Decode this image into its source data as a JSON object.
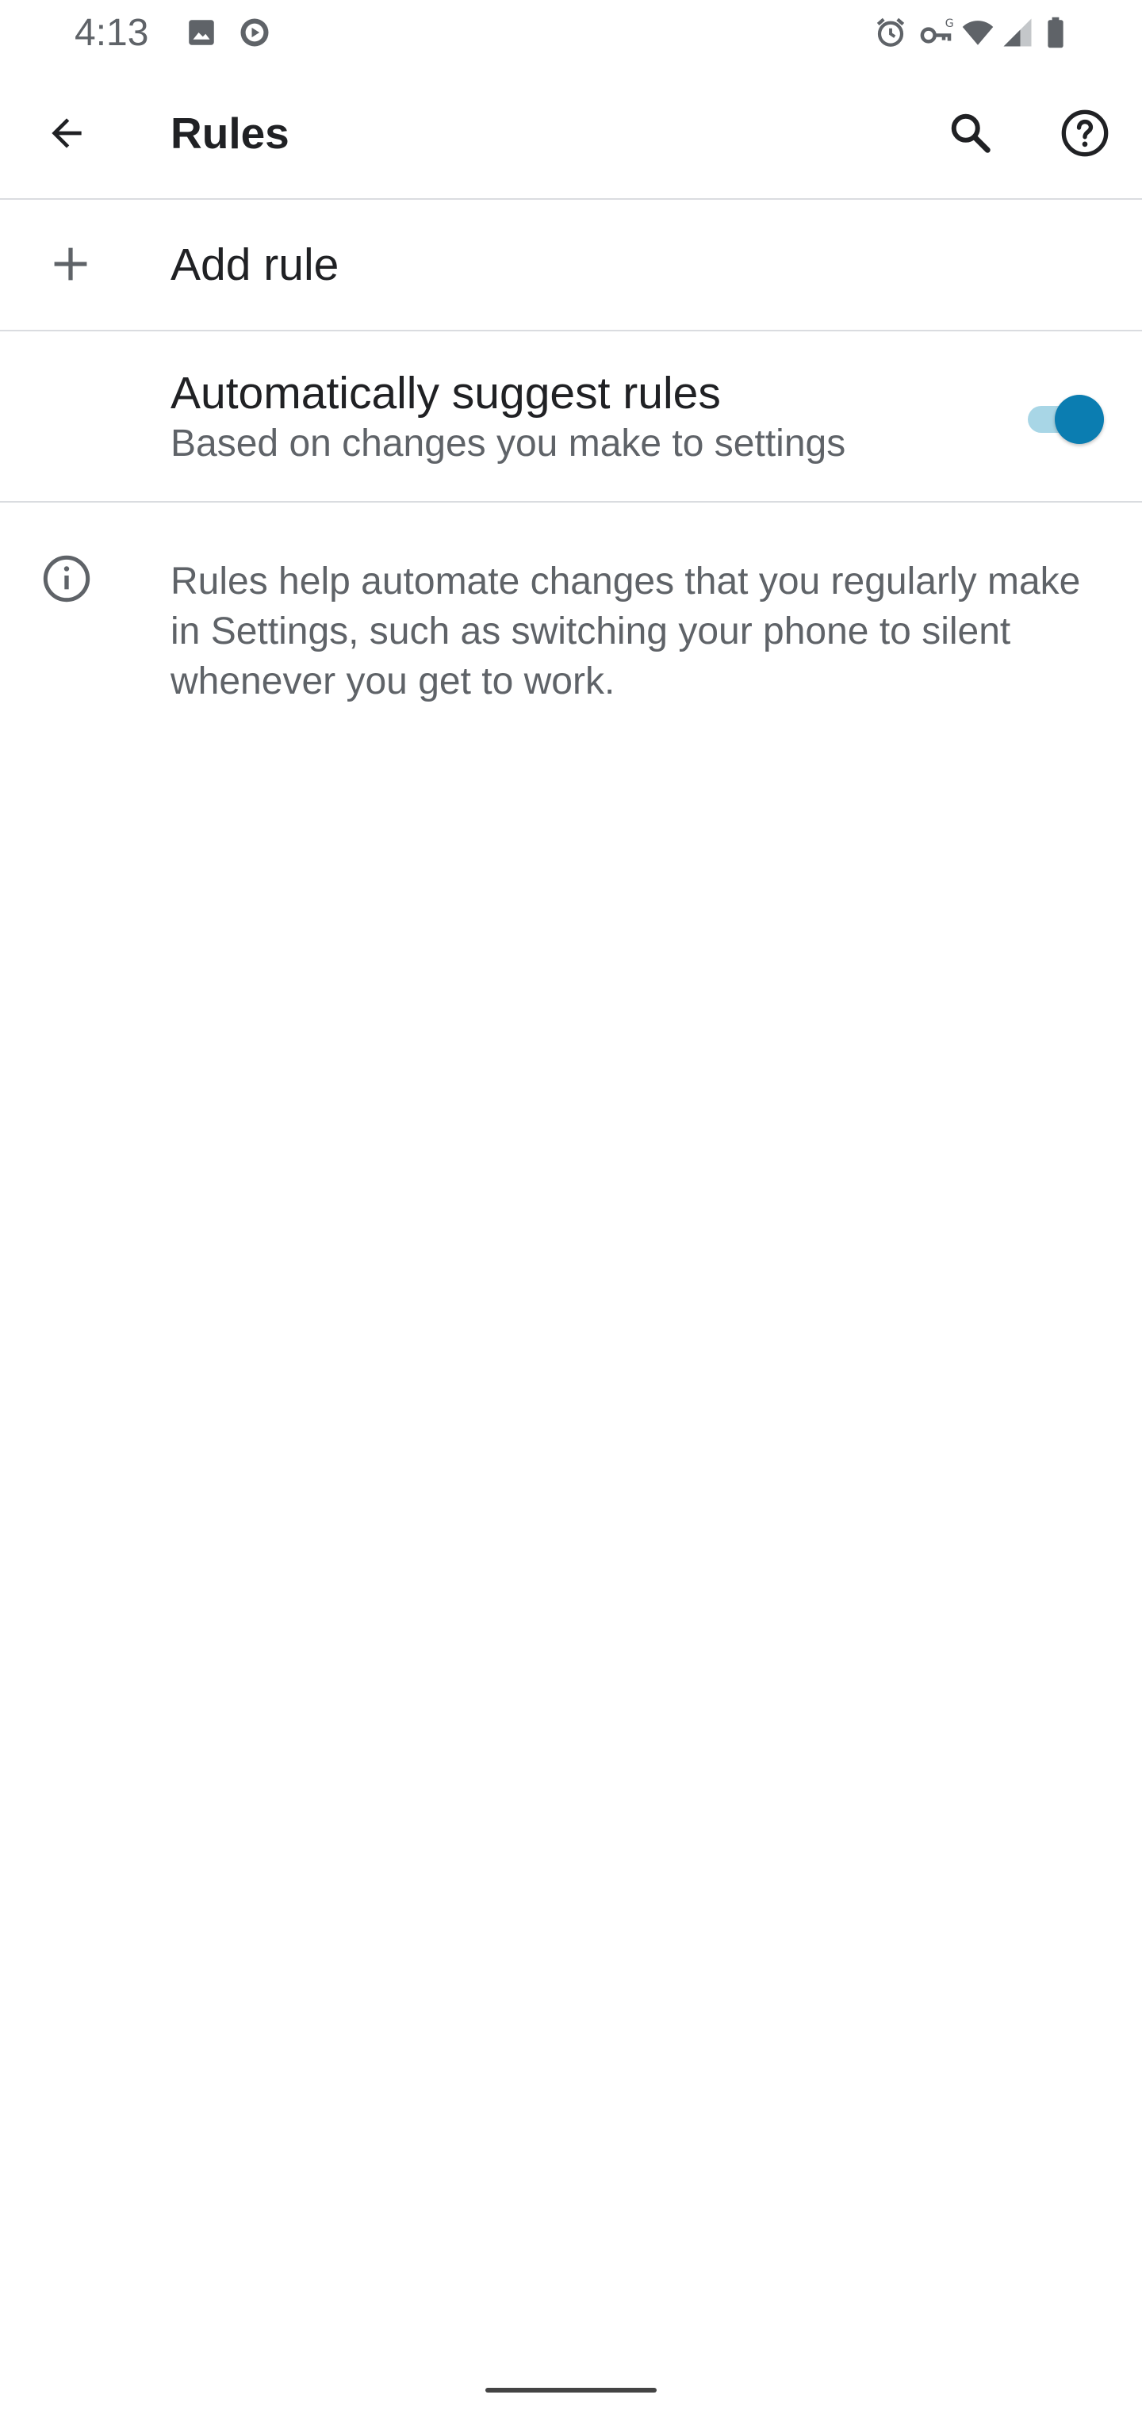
{
  "status_bar": {
    "time": "4:13",
    "left_icons": [
      "image-icon",
      "play-circle-icon"
    ],
    "right_icons": [
      "alarm-icon",
      "vpn-key-icon",
      "wifi-icon",
      "signal-icon",
      "battery-icon"
    ],
    "network_badge": "G"
  },
  "app_bar": {
    "title": "Rules",
    "icons": {
      "back": "arrow-back-icon",
      "search": "search-icon",
      "help": "help-icon"
    }
  },
  "add_rule": {
    "label": "Add rule",
    "icon": "plus-icon"
  },
  "suggest": {
    "title": "Automatically suggest rules",
    "summary": "Based on changes you make to settings",
    "toggle_on": true
  },
  "info": {
    "icon": "info-icon",
    "text": "Rules help automate changes that you regularly make in Settings, such as switching your phone to silent whenever you get to work."
  },
  "colors": {
    "accent": "#0b7db1",
    "accent_track": "#a8d6e6",
    "primary_text": "#202124",
    "secondary_text": "#5f6368",
    "divider": "#dadce0"
  }
}
